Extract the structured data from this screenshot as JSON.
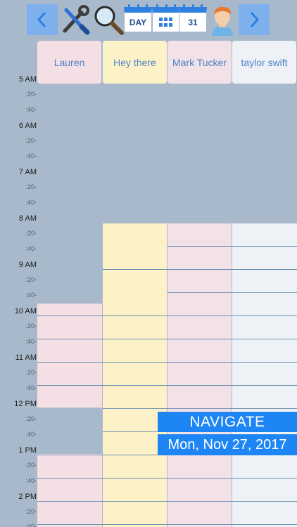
{
  "toolbar": {
    "prev_icon": "chevron-left-icon",
    "tools_icon": "wrench-screwdriver-icon",
    "search_icon": "magnifier-icon",
    "day_label": "DAY",
    "week_icon": "grid-calendar-icon",
    "month_label": "31",
    "user_icon": "avatar-icon",
    "next_icon": "chevron-right-icon"
  },
  "columns": [
    {
      "name": "Lauren",
      "color": "#f4dfe5"
    },
    {
      "name": "Hey there",
      "color": "#fdf2c7"
    },
    {
      "name": "Mark Tucker",
      "color": "#f2e1e6"
    },
    {
      "name": "taylor swift",
      "color": "#eef2f6"
    }
  ],
  "times": {
    "h5": "5 AM",
    "h6": "6 AM",
    "h7": "7 AM",
    "h8": "8 AM",
    "h9": "9 AM",
    "h10": "10 AM",
    "h11": "11 AM",
    "h12": "12 PM",
    "h13": "1 PM",
    "h14": "2 PM",
    "m20": ":20-",
    "m40": ":40-"
  },
  "navigate_label": "NAVIGATE",
  "date_label": "Mon, Nov 27, 2017",
  "colors": {
    "background": "#a7b9ca",
    "accent": "#1e86f4",
    "header_text": "#4e82c8"
  }
}
